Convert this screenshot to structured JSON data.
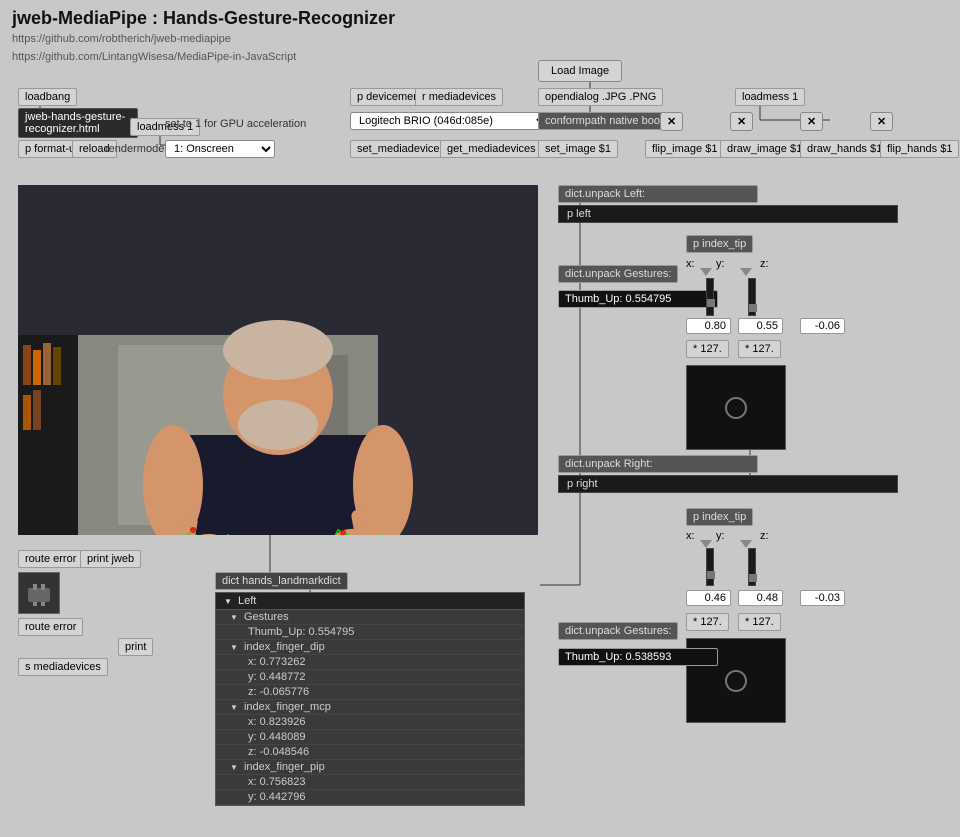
{
  "title": "jweb-MediaPipe : Hands-Gesture-Recognizer",
  "links": [
    "https://github.com/robtherich/jweb-mediapipe",
    "https://github.com/LintangWisesa/MediaPipe-in-JavaScript"
  ],
  "toolbar": {
    "load_image_label": "Load Image",
    "loadbang1": "loadbang",
    "loadbang2": "loadmess 1",
    "p_devicemenu": "p devicemenu",
    "r_mediadevices": "r mediadevices",
    "opendialog": "opendialog .JPG .PNG",
    "conformpath": "conformpath native boot",
    "set_image": "set_image $1",
    "flip_image": "flip_image $1",
    "draw_image": "draw_image $1",
    "draw_hands": "draw_hands $1",
    "flip_hands": "flip_hands $1",
    "loadmess1": "loadmess 1",
    "gpu_text": "set to 1 for GPU acceleration",
    "device_dropdown": "Logitech BRIO (046d:085e)",
    "rendermode_label": "rendermode",
    "rendermode_value": "1: Onscreen",
    "set_mediadevice": "set_mediadevice $1",
    "get_mediadevices": "get_mediadevices",
    "p_format_url": "p format-url",
    "reload": "reload",
    "jweb_node": "jweb-hands-gesture-recognizer.html"
  },
  "left_panel": {
    "dict_unpack_left": "dict.unpack Left:",
    "p_left": "p left",
    "dict_unpack_gestures": "dict.unpack Gestures:",
    "thumb_up_value": "Thumb_Up: 0.554795",
    "p_index_tip": "p index_tip",
    "x_label": "x:",
    "y_label": "y:",
    "z_label": "z:",
    "x_value": "0.80",
    "y_value": "0.55",
    "z_value": "-0.06",
    "mult_127_1": "* 127.",
    "mult_127_2": "* 127."
  },
  "right_panel": {
    "dict_unpack_right": "dict.unpack Right:",
    "p_right": "p right",
    "dict_unpack_gestures": "dict.unpack Gestures:",
    "thumb_up_value": "Thumb_Up: 0.538593",
    "p_index_tip": "p index_tip",
    "x_label": "x:",
    "y_label": "y:",
    "z_label": "z:",
    "x_value": "0.46",
    "y_value": "0.48",
    "z_value": "-0.03",
    "mult_127_1": "* 127.",
    "mult_127_2": "* 127."
  },
  "bottom_panel": {
    "route_error": "route error",
    "print_jweb": "print jweb",
    "dict_node": "dict hands_landmarkdict",
    "print": "print",
    "s_mediadevices": "s mediadevices",
    "dict_data": {
      "header": "Left",
      "gestures_header": "Gestures",
      "thumb_up": "Thumb_Up: 0.554795",
      "index_finger_dip": "index_finger_dip",
      "x_773": "x: 0.773262",
      "y_448": "y: 0.448772",
      "z_065": "z: -0.065776",
      "index_finger_mcp": "index_finger_mcp",
      "x_823": "x: 0.823926",
      "y_448_2": "y: 0.448089",
      "z_048": "z: -0.048546",
      "index_finger_pip": "index_finger_pip",
      "x_756": "x: 0.756823",
      "y_442": "y: 0.442796"
    }
  }
}
